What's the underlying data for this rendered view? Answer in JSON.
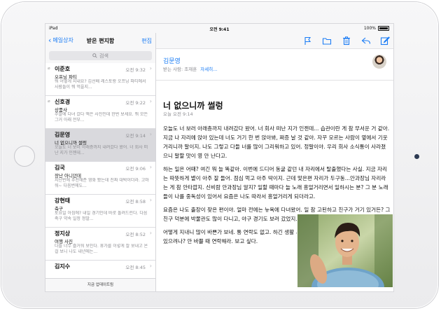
{
  "status_bar": {
    "carrier": "iPad",
    "time": "오전 9:41",
    "battery": "100%"
  },
  "sidebar": {
    "back_label": "메일상자",
    "title": "받은 편지함",
    "edit_label": "편집",
    "search_placeholder": "검색",
    "items": [
      {
        "sender": "이준호",
        "time": "오전 9:32",
        "subject": "오프닝 파티",
        "preview": "뭐 어떻게 지내요? 김선배 레스토랑 오프닝 파티에서 사람들이 뭐 먹을지...",
        "attachment": true
      },
      {
        "sender": "신호경",
        "time": "오전 9:22",
        "subject": "상품사",
        "preview": "주말에 다녀 갔다 액은 사진인데 한번 보세요. 뭐 모든 그거 아래 전부...",
        "attachment": true
      },
      {
        "sender": "김문영",
        "time": "오전 9:14",
        "subject": "너 없으니까 썰렁",
        "preview": "오늘도 너 보러 아래층까지 내려갔다 왔어. 너 회사 떠난 지가 인젠데...",
        "attachment": false,
        "selected": true
      },
      {
        "sender": "김국",
        "time": "오전 9:06",
        "subject": "장난 아니던데",
        "preview": "지난번에 추천해준 영화 봤는데 진짜 대박이더라. 고마워~ 다음번에도...",
        "attachment": false
      },
      {
        "sender": "강현태",
        "time": "오전 8:58",
        "subject": "축구",
        "preview": "토요일 아침에? 내일 경기인데 바로 돌려드린다. 다음 축구 약속 일정 정말...",
        "attachment": false
      },
      {
        "sender": "정지상",
        "time": "오전 8:52",
        "subject": "여행 사진",
        "preview": "다들 너무 즐거워 보인다. 휴가를 이렇게 잘 보내고 온 걸 보니 나도 내년에는...",
        "attachment": false
      },
      {
        "sender": "김지수",
        "time": "오전 8:45",
        "subject": "",
        "preview": "",
        "attachment": false
      }
    ],
    "footer": "지금 업데이트됨"
  },
  "message": {
    "from": "김문영",
    "to_label": "받는 사람: 조재훈",
    "details_label": "자세히...",
    "subject": "너 없으니까 썰렁",
    "date": "오늘 오전 9:14",
    "paragraphs": [
      "오늘도 너 보러 아래층까지 내려갔다 왔어. 너 회사 떠난 지가 인젠데... 습관이란 게 참 무서운 거 같아. 지금 나 자리에 앉아 있는데 너도 거기 한 번 앉아봐, 쩌증 날 것 같아. 자꾸 모르는 사람이 옆에서 기웃거리니까 말이지. 나도 그렇고 다들 너를 많이 그리워하고 있어. 정말이야. 우리 회사 소식통이 사라졌으니 말할 맛이 영 안 난다고.",
      "하는 일은 어때? 여긴 뭐 늘 똑같아. 이번에 드디어 동굴 같던 내 자리에서 탈출했다는 사실. 지금 자리는 따뜻하게 볕이 아주 잘 들어. 점심 먹고 아주 딱이지. 근데 맞은편 자리가 두구동...안과장님 자리라는 게 참 안타깝지. 신비람 안과장님 알지? 일할 때마다 늘 노래 흥얼거리면서 일하시는 분? 그 분 노래들이 나를 중독성이 있어서 요즘은 나도 따라서 흥얼거리게 되더라고.",
      "요즘은 나도 출장이 잦은 편이야. 얼마 전에는 뉴욕에 다녀왔어. 일 참 고된하고 친구가 거기 있거든? 그 친구 덕분에 박물관도 많이 다니고, 야구 경기도 보러 갔었지.",
      "어떻게 지내니 많이 바쁜가 보네. 통 연락도 없고. 하긴 생활 시작하면 다들 그렇지 뭐. 식당 노트 하나 있으려나? 안 바쁠 때 연락해라. 보고 싶다."
    ]
  }
}
